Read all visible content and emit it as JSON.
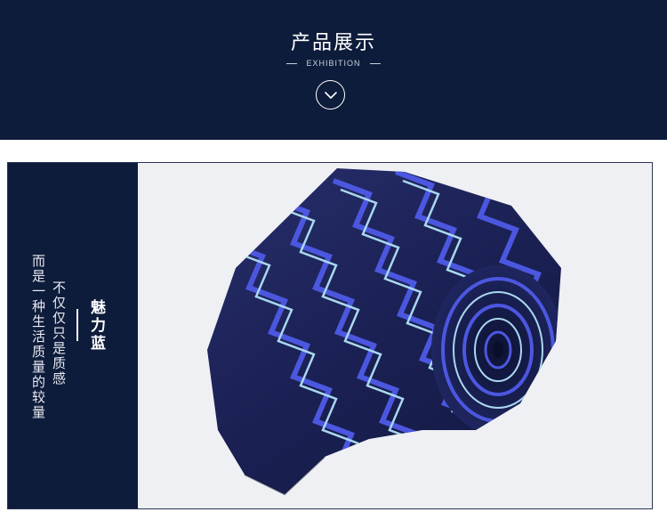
{
  "header": {
    "title": "产品展示",
    "subtitle": "EXHIBITION",
    "chevron_icon": "chevron-down-icon"
  },
  "side_text": {
    "column_1": "而是一种生活质量的较量",
    "column_2": "不仅仅只是质感",
    "column_3": "魅力蓝"
  },
  "colors": {
    "navy": "#0e1c3b",
    "tie_base": "#1b2153",
    "stripe_blue": "#4c57e0",
    "stripe_light": "#a9d8f0"
  }
}
